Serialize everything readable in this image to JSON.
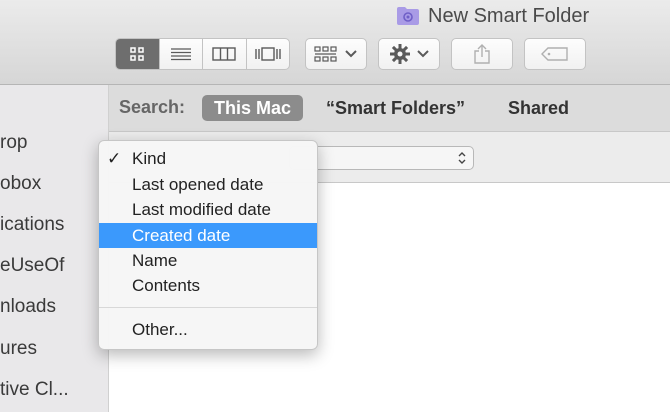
{
  "window": {
    "title": "New Smart Folder"
  },
  "toolbar": {
    "view_modes": [
      "icon-view",
      "list-view",
      "column-view",
      "cover-flow-view"
    ],
    "active_view": "icon-view"
  },
  "sidebar": {
    "items": [
      {
        "label": "rop"
      },
      {
        "label": "obox"
      },
      {
        "label": "ications"
      },
      {
        "label": "eUseOf"
      },
      {
        "label": "nloads"
      },
      {
        "label": "ures"
      },
      {
        "label": "tive Cl..."
      }
    ]
  },
  "search": {
    "label": "Search:",
    "scopes": [
      {
        "label": "This Mac",
        "active": true
      },
      {
        "label": "“Smart Folders”",
        "active": false
      },
      {
        "label": "Shared",
        "active": false
      }
    ]
  },
  "menu": {
    "items": [
      {
        "label": "Kind",
        "checked": true
      },
      {
        "label": "Last opened date"
      },
      {
        "label": "Last modified date"
      },
      {
        "label": "Created date",
        "highlighted": true
      },
      {
        "label": "Name"
      },
      {
        "label": "Contents"
      }
    ],
    "other": "Other..."
  },
  "colors": {
    "highlight": "#3b99fc",
    "folder": "#a99be6"
  }
}
